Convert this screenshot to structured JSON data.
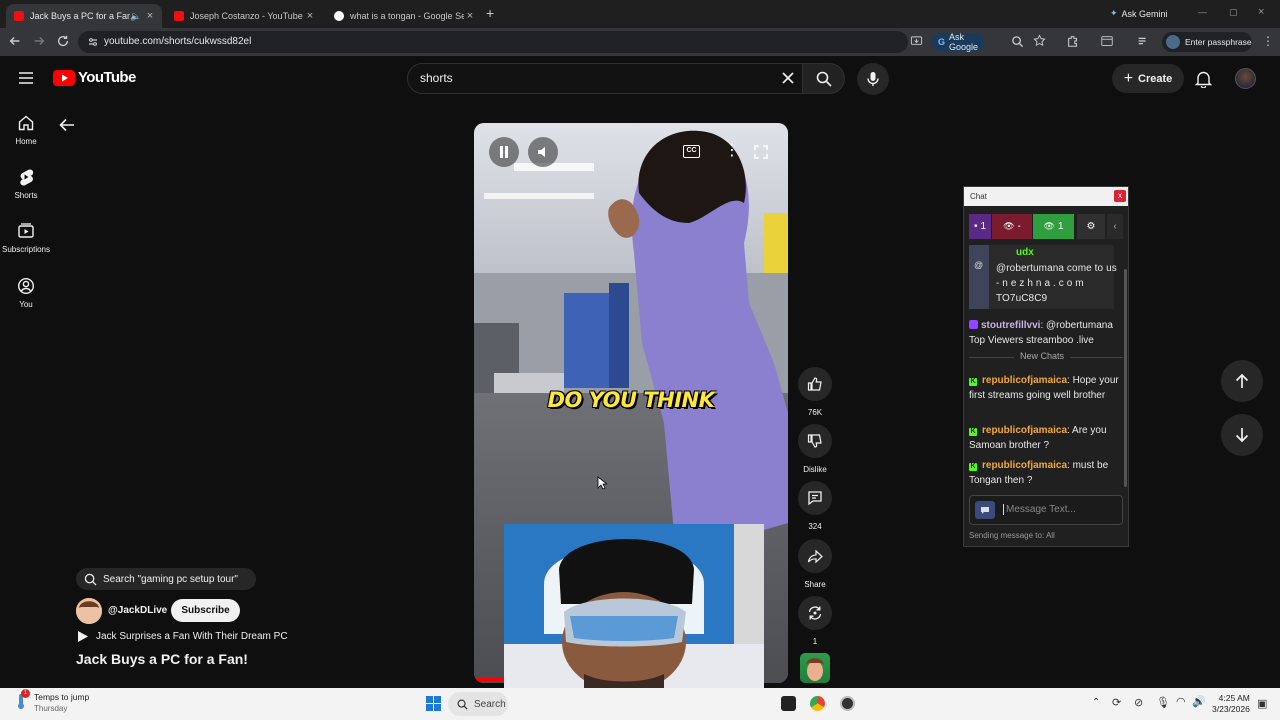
{
  "browser": {
    "tabs": [
      {
        "title": "Jack Buys a PC for a Fan! - Y",
        "active": true
      },
      {
        "title": "Joseph Costanzo - YouTube",
        "active": false
      },
      {
        "title": "what is a tongan - Google Sear",
        "active": false
      }
    ],
    "new_tab": "+",
    "ask_gemini": "Ask Gemini",
    "url": "youtube.com/shorts/cukwssd82el",
    "ask_google": "Ask Google",
    "enter_passphrase": "Enter passphrase"
  },
  "youtube": {
    "logo_text": "YouTube",
    "search_value": "shorts",
    "create_label": "Create",
    "nav": [
      {
        "label": "Home",
        "icon": "home-icon"
      },
      {
        "label": "Shorts",
        "icon": "shorts-icon"
      },
      {
        "label": "Subscriptions",
        "icon": "subscriptions-icon"
      },
      {
        "label": "You",
        "icon": "you-icon"
      }
    ]
  },
  "short": {
    "caption_text": "DO YOU THINK",
    "likes": "76K",
    "dislike_label": "Dislike",
    "comments": "324",
    "share_label": "Share",
    "remix_count": "1",
    "search_chip": "Search \"gaming pc setup tour\"",
    "channel": "@JackDLive",
    "subscribe_label": "Subscribe",
    "playlist_title": "Jack Surprises a Fan With Their Dream PC",
    "title": "Jack Buys a PC for a Fan!"
  },
  "chat": {
    "title": "Chat",
    "close": "x",
    "chips": [
      {
        "text": "1",
        "color": "#5b2a86"
      },
      {
        "text": "-",
        "color": "#7a1b2e"
      },
      {
        "text": "1",
        "color": "#2e9e3e"
      }
    ],
    "pinned": {
      "user": "udx",
      "text": "@robertumana come to us - n e z h n a . c o m TO7uC8C9"
    },
    "messages": [
      {
        "user": "stoutrefillvvi",
        "text": ": @robertumana Top Viewers streamboo .live",
        "platform": "twitch",
        "user_color": "#c6b4e6"
      },
      {
        "user": "republicofjamaica",
        "text": ": Hope your first streams going well brother",
        "platform": "kick",
        "user_color": "#f2a93b"
      },
      {
        "user": "republicofjamaica",
        "text": ": Are you Samoan brother ?",
        "platform": "kick",
        "user_color": "#f2a93b"
      },
      {
        "user": "republicofjamaica",
        "text": ": must be Tongan then ?",
        "platform": "kick",
        "user_color": "#f2a93b"
      }
    ],
    "divider": "New Chats",
    "input_placeholder": "Message Text...",
    "sending_to": "Sending message to: All"
  },
  "taskbar": {
    "notification_title": "Temps to jump",
    "notification_sub": "Thursday",
    "search_label": "Search",
    "time": "4:25 AM",
    "date": "3/23/2026"
  }
}
